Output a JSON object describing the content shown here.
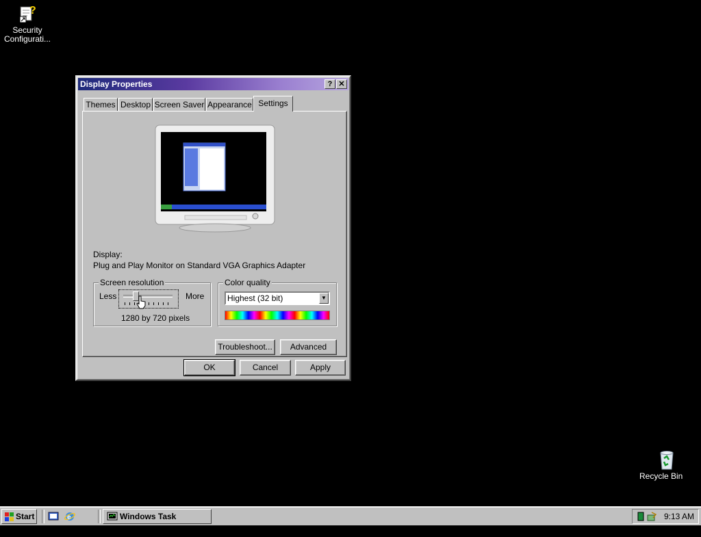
{
  "desktop": {
    "icons": [
      {
        "label": "Security Configurati...",
        "icon": "security-config-shortcut-icon"
      },
      {
        "label": "Recycle Bin",
        "icon": "recycle-bin-icon"
      }
    ]
  },
  "dialog": {
    "title": "Display Properties",
    "help_glyph": "?",
    "close_glyph": "✕",
    "tabs": [
      "Themes",
      "Desktop",
      "Screen Saver",
      "Appearance",
      "Settings"
    ],
    "active_tab": "Settings",
    "display_label": "Display:",
    "display_value": "Plug and Play Monitor on Standard VGA Graphics Adapter",
    "resolution": {
      "legend": "Screen resolution",
      "less": "Less",
      "more": "More",
      "value": "1280 by 720 pixels",
      "slider_position": 0.25
    },
    "color": {
      "legend": "Color quality",
      "selected": "Highest (32 bit)"
    },
    "buttons": {
      "troubleshoot": "Troubleshoot...",
      "advanced": "Advanced",
      "ok": "OK",
      "cancel": "Cancel",
      "apply": "Apply"
    }
  },
  "taskbar": {
    "start": "Start",
    "tasks": [
      "Windows Task Manag..."
    ],
    "clock": "9:13 AM"
  },
  "colors": {
    "desktop": "#000000",
    "face": "#c0c0c0",
    "title_start": "#1d2a7a",
    "title_end": "#b7a6e0"
  }
}
